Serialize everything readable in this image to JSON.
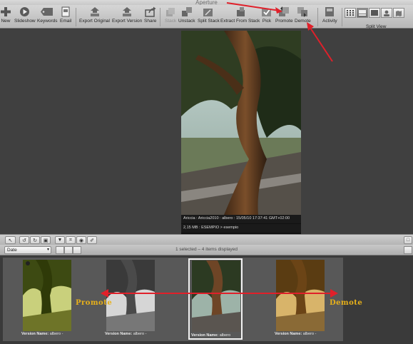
{
  "window": {
    "title": "Aperture"
  },
  "toolbar": {
    "items": [
      {
        "label": "New",
        "icon": "plus-icon"
      },
      {
        "label": "Slideshow",
        "icon": "play-icon"
      },
      {
        "label": "Keywords",
        "icon": "tag-icon"
      },
      {
        "label": "Email",
        "icon": "email-icon"
      },
      {
        "label": "Export Original",
        "icon": "export-icon"
      },
      {
        "label": "Export Version",
        "icon": "export-icon"
      },
      {
        "label": "Share",
        "icon": "share-icon"
      },
      {
        "label": "Stack",
        "icon": "stack-icon"
      },
      {
        "label": "Unstack",
        "icon": "unstack-icon"
      },
      {
        "label": "Split Stack",
        "icon": "split-stack-icon"
      },
      {
        "label": "Extract From Stack",
        "icon": "extract-icon"
      },
      {
        "label": "Pick",
        "icon": "pick-icon"
      },
      {
        "label": "Promote",
        "icon": "promote-icon"
      },
      {
        "label": "Demote",
        "icon": "demote-icon"
      },
      {
        "label": "Activity",
        "icon": "activity-icon"
      }
    ],
    "split_view_label": "Split View"
  },
  "viewer": {
    "meta_line1": "Ariccia : Ariccia2010 : albero : 15/05/10 17:37:41 GMT+02:00",
    "meta_line2": "2,15 MB : ESEMPIO > esempio"
  },
  "browser": {
    "sort_value": "Date",
    "status": "1 selected – 4 items displayed",
    "thumbnails": [
      {
        "caption_label": "Version Name:",
        "caption_value": "albero -",
        "selected": false
      },
      {
        "caption_label": "Version Name:",
        "caption_value": "albero -",
        "selected": false
      },
      {
        "caption_label": "Version Name:",
        "caption_value": "albero",
        "selected": true
      },
      {
        "caption_label": "Version Name:",
        "caption_value": "albero -",
        "selected": false
      }
    ]
  },
  "annotations": {
    "promote_label": "Promote",
    "demote_label": "Demote",
    "accent_color": "#e8b11a",
    "arrow_color": "#e0202a"
  }
}
